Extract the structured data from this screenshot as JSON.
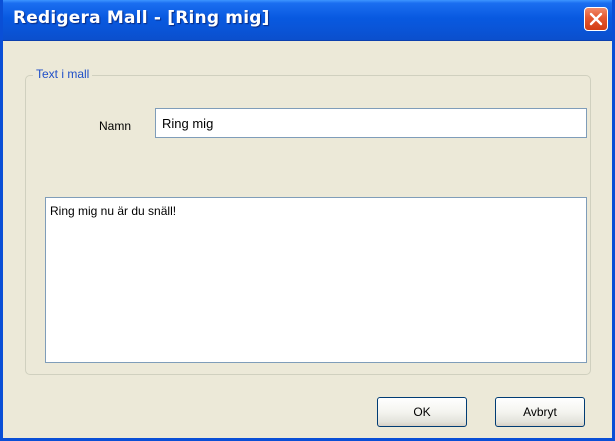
{
  "window": {
    "title": "Redigera Mall - [Ring mig]"
  },
  "group": {
    "legend": "Text i mall"
  },
  "name_field": {
    "label": "Namn",
    "value": "Ring mig"
  },
  "message_field": {
    "value": "Ring mig nu är du snäll!"
  },
  "buttons": {
    "ok_label": "OK",
    "cancel_label": "Avbryt"
  },
  "icons": {
    "close": "close-icon"
  },
  "colors": {
    "titlebar": "#0859e0",
    "close_button": "#e4572f",
    "legend_text": "#1f4fc8",
    "dialog_background": "#ece9d8"
  }
}
